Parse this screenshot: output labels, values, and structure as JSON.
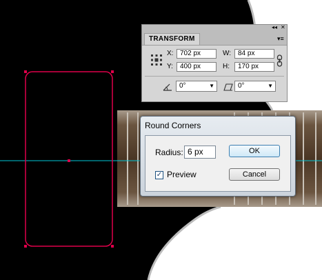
{
  "transform_panel": {
    "tab_label": "TRANSFORM",
    "collapse_glyph": "◂◂",
    "close_glyph": "✕",
    "menu_glyph": "▾≡",
    "x_label": "X:",
    "x_value": "702 px",
    "y_label": "Y:",
    "y_value": "400 px",
    "w_label": "W:",
    "w_value": "84 px",
    "h_label": "H:",
    "h_value": "170 px",
    "rotate_value": "0°",
    "shear_value": "0°",
    "link_icon": "chain-link-icon",
    "reference_point_icon": "reference-point-grid-icon",
    "rotate_icon": "rotate-angle-icon",
    "shear_icon": "shear-angle-icon"
  },
  "round_corners_dialog": {
    "title": "Round Corners",
    "radius_label": "Radius:",
    "radius_value": "6 px",
    "preview_label": "Preview",
    "preview_checked": true,
    "ok_label": "OK",
    "cancel_label": "Cancel"
  },
  "colors": {
    "canvas_black": "#000000",
    "selection": "#e0004a",
    "guide": "#00c8d8",
    "wood": "#5a4530"
  }
}
